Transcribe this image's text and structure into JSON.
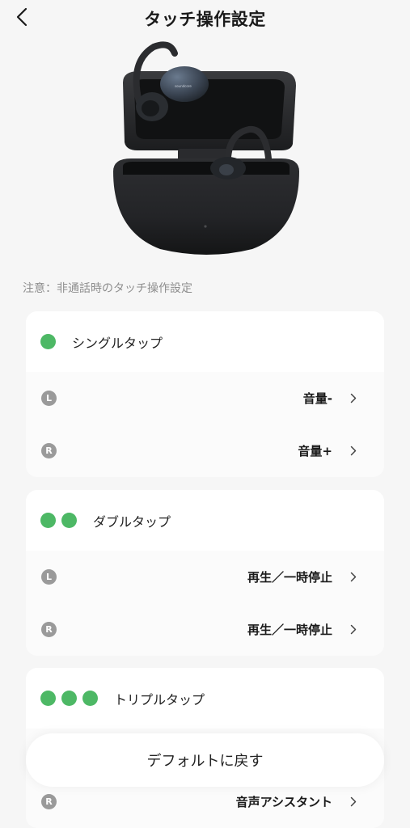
{
  "header": {
    "title": "タッチ操作設定"
  },
  "note": "注意：非通話時のタッチ操作設定",
  "colors": {
    "accent_dot": "#4db865",
    "badge": "#9a9a9a",
    "background": "#f6f6f6"
  },
  "icons": {
    "back": "chevron-left-icon",
    "row_arrow": "chevron-right-icon"
  },
  "sections": [
    {
      "title": "シングルタップ",
      "rows": [
        {
          "side": "L",
          "value": "音量-"
        },
        {
          "side": "R",
          "value": "音量+"
        }
      ]
    },
    {
      "title": "ダブルタップ",
      "rows": [
        {
          "side": "L",
          "value": "再生／一時停止"
        },
        {
          "side": "R",
          "value": "再生／一時停止"
        }
      ]
    },
    {
      "title": "トリプルタップ",
      "rows": [
        {
          "side": "R",
          "value": "音声アシスタント"
        }
      ]
    }
  ],
  "reset_button": "デフォルトに戻す"
}
